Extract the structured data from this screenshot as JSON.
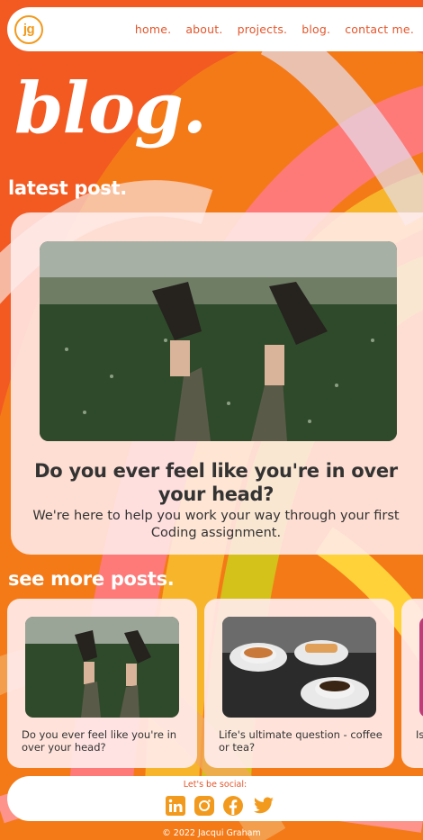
{
  "nav": {
    "logo_text": "jg",
    "links": [
      "home.",
      "about.",
      "projects.",
      "blog.",
      "contact me."
    ]
  },
  "page_title": "blog.",
  "latest": {
    "heading": "latest post.",
    "post_title": "Do you ever feel like you're in over your head?",
    "post_subtitle": "We're here to help you work your way through your first Coding assignment."
  },
  "more": {
    "heading": "see more posts.",
    "posts": [
      {
        "title": "Do you ever feel like you're in over your head?"
      },
      {
        "title": "Life's ultimate question - coffee or tea?"
      },
      {
        "title": "Is"
      }
    ]
  },
  "social": {
    "label": "Let's be social:",
    "icons": [
      "linkedin-icon",
      "instagram-icon",
      "facebook-icon",
      "twitter-icon"
    ]
  },
  "footer": {
    "copyright": "© 2022 Jacqui Graham"
  },
  "colors": {
    "accent": "#e4562b",
    "social_icon": "#f29a1d",
    "background_orange": "#f47a18",
    "card_bg": "#ffecec"
  }
}
